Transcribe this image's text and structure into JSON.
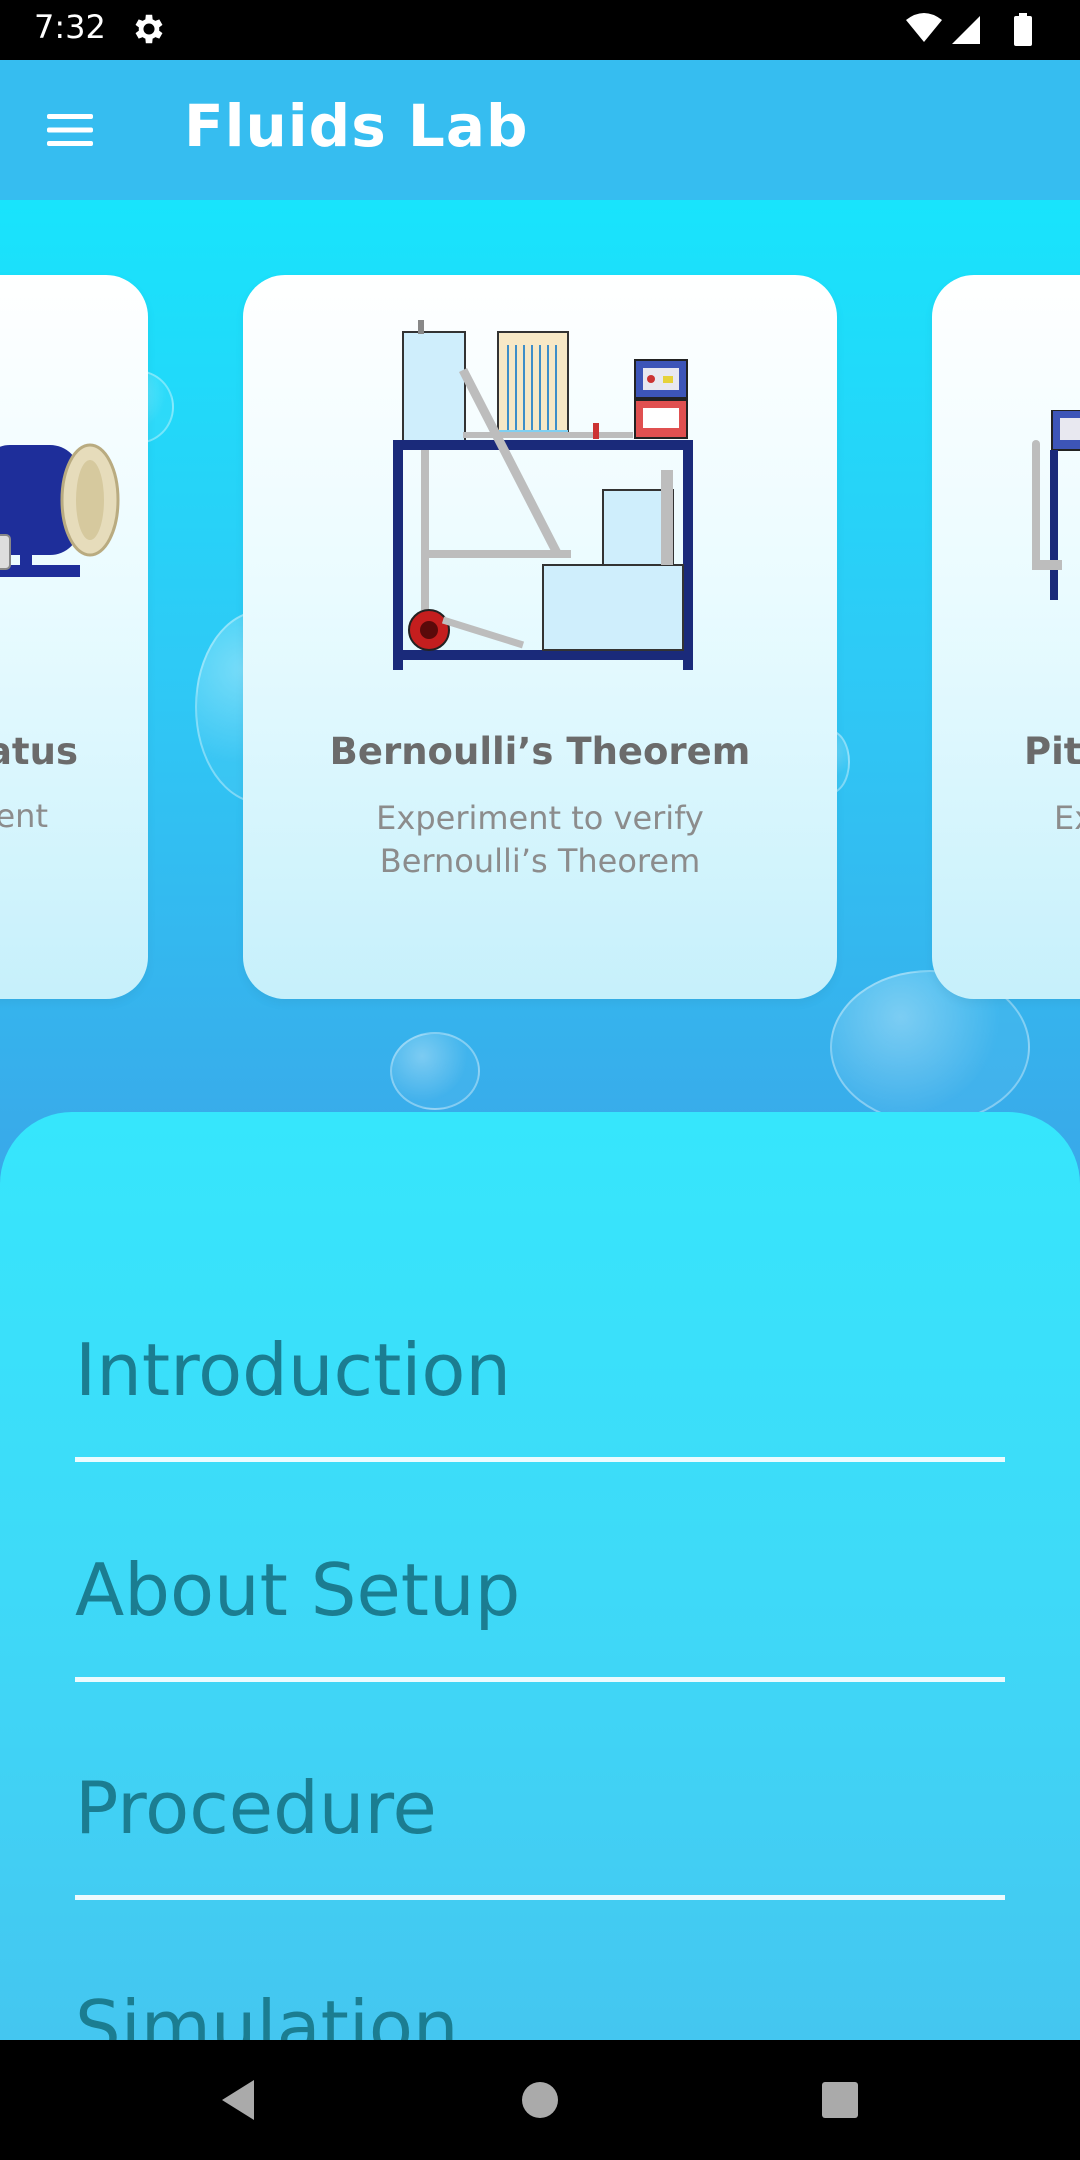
{
  "status_bar": {
    "time": "7:32",
    "icons": [
      "gear-icon",
      "wifi-icon",
      "signal-icon",
      "battery-icon"
    ]
  },
  "app_bar": {
    "title": "Fluids Lab",
    "menu_icon": "hamburger-menu-icon"
  },
  "carousel": {
    "left_card": {
      "title_partial": "atus",
      "desc_partial": "ent"
    },
    "center_card": {
      "title": "Bernoulli’s Theorem",
      "description_line1": "Experiment to verify",
      "description_line2": "Bernoulli’s Theorem"
    },
    "right_card": {
      "title_partial": "Pit",
      "desc_partial": "Ex"
    }
  },
  "menu": {
    "items": [
      {
        "label": "Introduction"
      },
      {
        "label": "About Setup"
      },
      {
        "label": "Procedure"
      },
      {
        "label": "Simulation"
      }
    ]
  },
  "nav_bar": {
    "icons": [
      "back-icon",
      "home-icon",
      "recents-icon"
    ]
  },
  "colors": {
    "app_bar": "#36bdf0",
    "sheet": "#3edaf8",
    "menu_text": "#1b7d91",
    "card_title": "#6b6b6b"
  }
}
